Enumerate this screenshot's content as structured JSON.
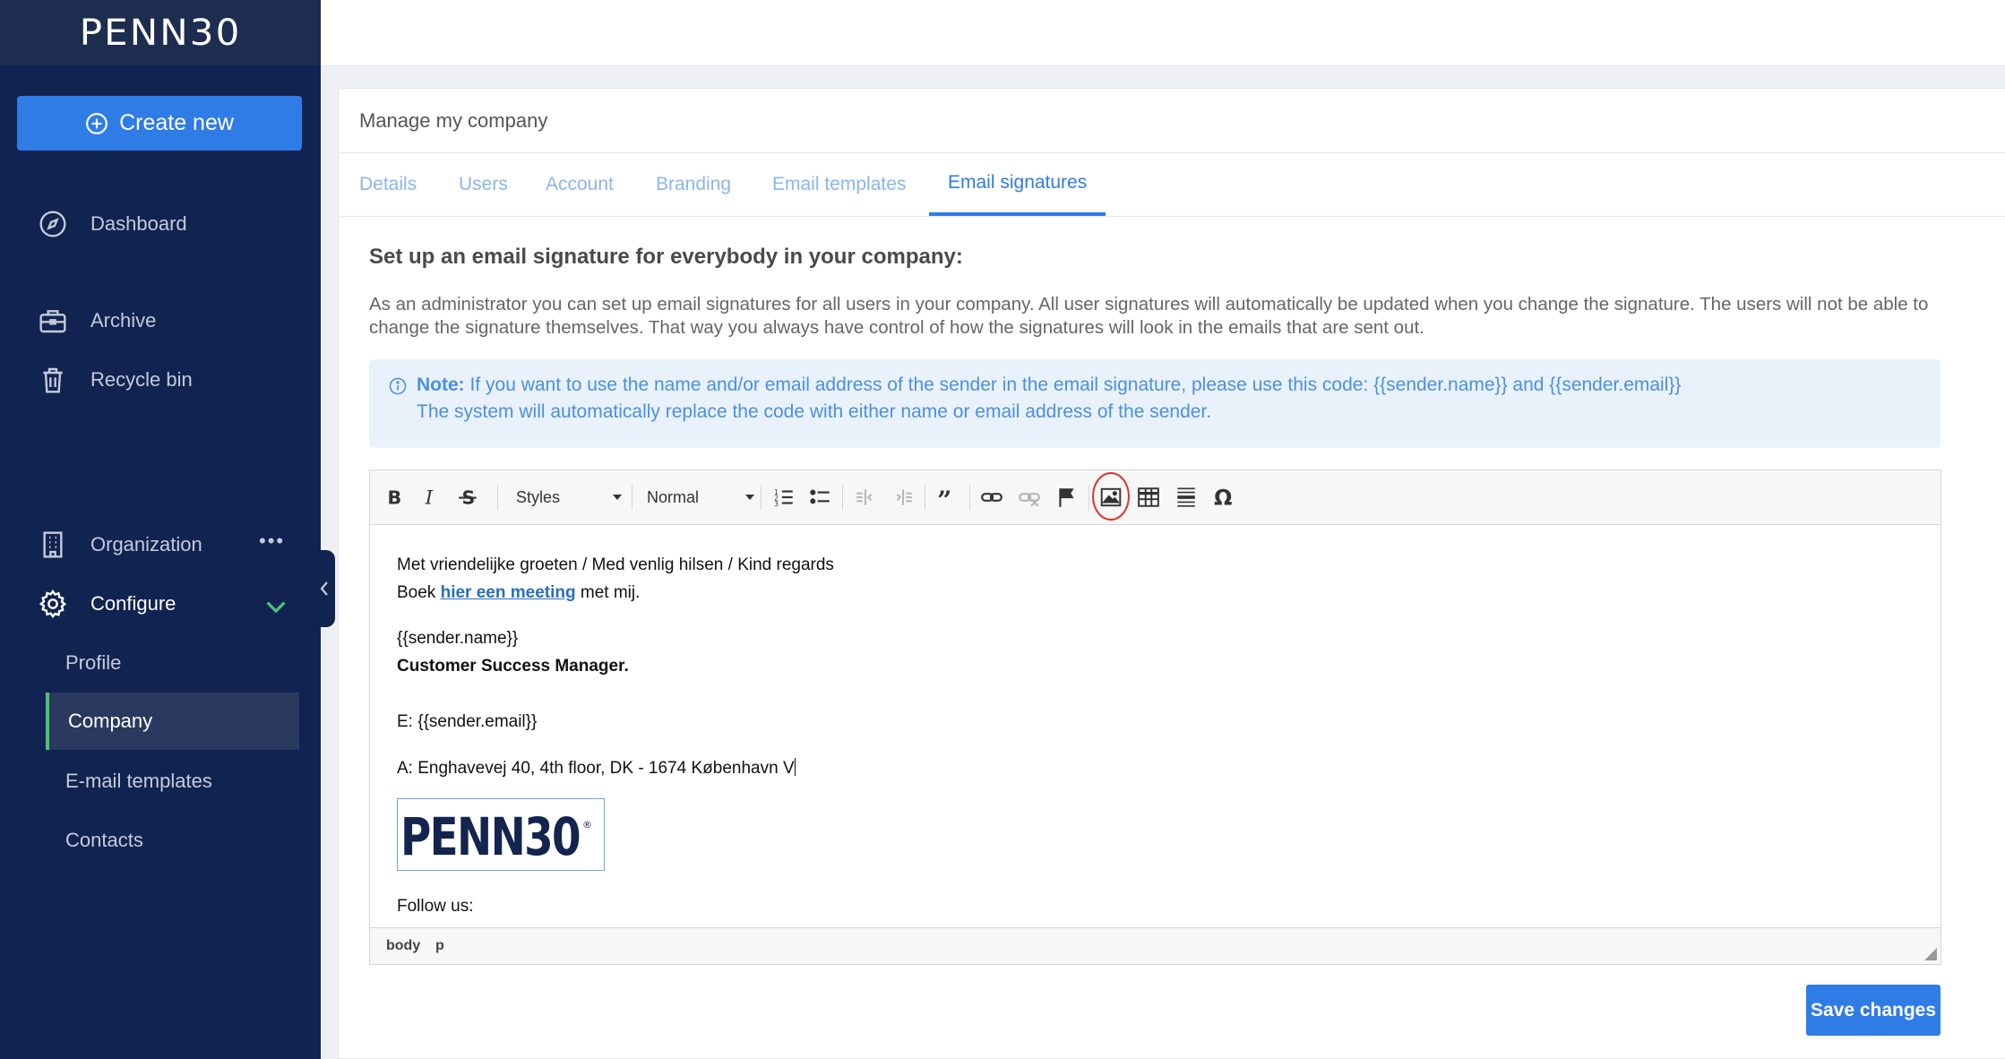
{
  "brand": {
    "logo_text": "PENN30",
    "signature_logo_text": "PENN30"
  },
  "sidebar": {
    "create_label": "Create new",
    "nav": [
      {
        "label": "Dashboard",
        "icon": "compass-icon"
      },
      {
        "label": "Archive",
        "icon": "briefcase-icon"
      },
      {
        "label": "Recycle bin",
        "icon": "trash-icon"
      },
      {
        "label": "Organization",
        "icon": "building-icon",
        "more": "•••"
      },
      {
        "label": "Configure",
        "icon": "gear-icon"
      }
    ],
    "configure_items": [
      {
        "label": "Profile"
      },
      {
        "label": "Company",
        "active": true
      },
      {
        "label": "E-mail templates"
      },
      {
        "label": "Contacts"
      }
    ]
  },
  "page": {
    "title": "Manage my company",
    "tabs": [
      {
        "label": "Details"
      },
      {
        "label": "Users"
      },
      {
        "label": "Account"
      },
      {
        "label": "Branding"
      },
      {
        "label": "Email templates"
      },
      {
        "label": "Email signatures",
        "active": true
      }
    ],
    "heading": "Set up an email signature for everybody in your company:",
    "description": "As an administrator you can set up email signatures for all users in your company. All user signatures will automatically be updated when you change the signature. The users will not be able to change the signature themselves. That way you always have control of how the signatures will look in the emails that are sent out.",
    "note": {
      "label": "Note:",
      "line1": "If you want to use the name and/or email address of the sender in the email signature, please use this code: {{sender.name}} and {{sender.email}}",
      "line2": "The system will automatically replace the code with either name or email address of the sender."
    }
  },
  "editor": {
    "styles_label": "Styles",
    "format_label": "Normal",
    "content": {
      "greeting": "Met vriendelijke groeten / Med venlig hilsen / Kind regards",
      "book_prefix": "Boek ",
      "book_link": "hier een meeting",
      "book_suffix": " met mij.",
      "name": "{{sender.name}}",
      "role": "Customer Success Manager.",
      "email": "E: {{sender.email}}",
      "address": "A: Enghavevej 40, 4th floor, DK - 1674 København V",
      "follow": "Follow us:"
    },
    "status_path": [
      "body",
      "p"
    ]
  },
  "save_label": "Save changes",
  "colors": {
    "sidebar_bg": "#112350",
    "accent": "#2f7ce6",
    "active_marker": "#4fbf76",
    "highlight_ring": "#e0332b"
  }
}
